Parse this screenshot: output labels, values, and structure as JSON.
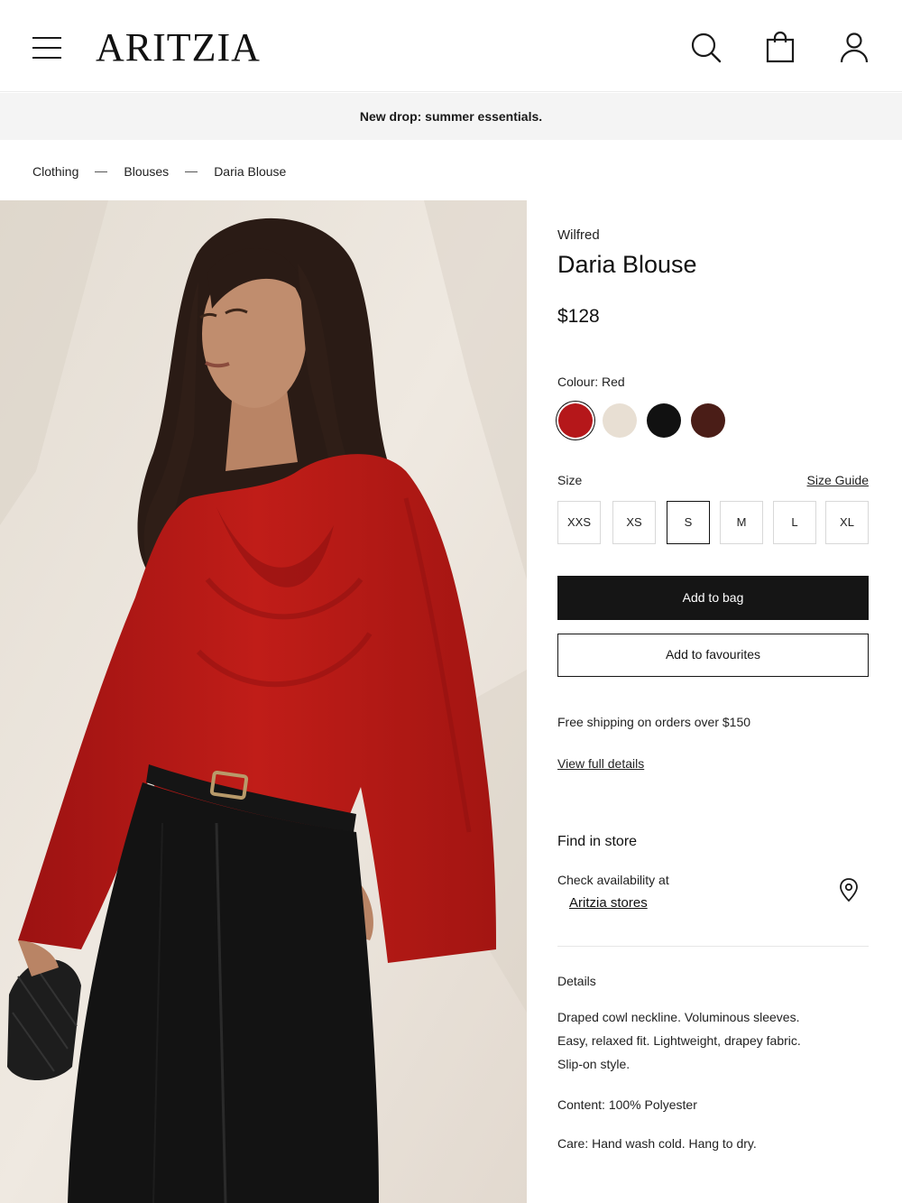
{
  "header": {
    "logo": "ARITZIA",
    "icons": [
      "menu-icon",
      "search-icon",
      "shopping-bag-icon",
      "account-icon"
    ]
  },
  "banner": {
    "text": "New drop: summer essentials."
  },
  "breadcrumb": [
    "Clothing",
    "Blouses",
    "Daria Blouse"
  ],
  "product": {
    "brand": "Wilfred",
    "name": "Daria Blouse",
    "price": "$128",
    "colour_label": "Colour: Red",
    "swatches": [
      {
        "name": "red",
        "color": "#b5171a",
        "selected": true
      },
      {
        "name": "cream",
        "color": "#e8dfd3",
        "selected": false
      },
      {
        "name": "black",
        "color": "#111111",
        "selected": false
      },
      {
        "name": "brown",
        "color": "#4a1d17",
        "selected": false
      }
    ],
    "size_label": "Size",
    "size_guide": "Size Guide",
    "sizes": [
      "XXS",
      "XS",
      "S",
      "M",
      "L",
      "XL"
    ],
    "selected_size": "S",
    "add_to_bag": "Add to bag",
    "add_to_favourites": "Add to favourites",
    "shipping": "Free shipping on orders over $150",
    "view_full_details": "View full details"
  },
  "store": {
    "title": "Find in store",
    "check_text": "Check availability at",
    "link": "Aritzia stores"
  },
  "details": {
    "title": "Details",
    "lines": [
      "Draped cowl neckline. Voluminous sleeves.",
      "Easy, relaxed fit. Lightweight, drapey fabric.",
      "Slip-on style.",
      "Content: 100% Polyester",
      "Care: Hand wash cold. Hang to dry."
    ]
  },
  "colors": {
    "accent_dark": "#151515",
    "banner_bg": "#f4f4f4",
    "blouse_red": "#b5171a"
  }
}
